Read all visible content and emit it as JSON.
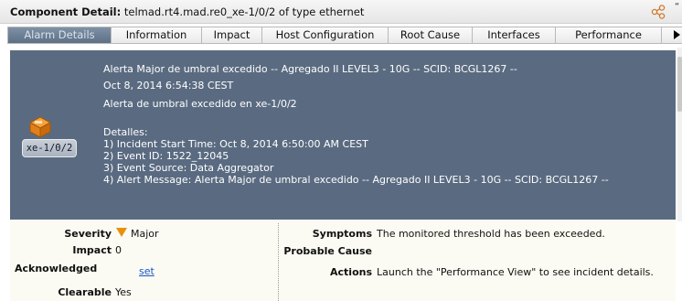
{
  "header": {
    "title_bold": "Component Detail:",
    "title_rest": " telmad.rt4.mad.re0_xe-1/0/2 of type ethernet",
    "share_icon": "share-icon"
  },
  "tabs": [
    {
      "label": "Alarm Details",
      "active": true
    },
    {
      "label": "Information",
      "active": false
    },
    {
      "label": "Impact",
      "active": false
    },
    {
      "label": "Host Configuration",
      "active": false
    },
    {
      "label": "Root Cause",
      "active": false
    },
    {
      "label": "Interfaces",
      "active": false
    },
    {
      "label": "Performance",
      "active": false
    }
  ],
  "alarm": {
    "headline": "Alerta Major de umbral excedido -- Agregado II LEVEL3 - 10G -- SCID: BCGL1267 --",
    "timestamp": "Oct 8, 2014 6:54:38 CEST",
    "summary": "Alerta de umbral excedido en xe-1/0/2",
    "details_title": "Detalles:",
    "details": [
      "1) Incident Start Time: Oct 8, 2014 6:50:00 AM CEST",
      "2) Event ID: 1522_12045",
      "3) Event Source: Data Aggregator",
      "4) Alert Message: Alerta Major de umbral excedido -- Agregado II LEVEL3 - 10G -- SCID: BCGL1267 --"
    ],
    "device_label": "xe-1/0/2"
  },
  "fields": {
    "severity_label": "Severity",
    "severity_value": "Major",
    "impact_label": "Impact",
    "impact_value": "0",
    "acknowledged_label": "Acknowledged",
    "acknowledged_link": "set",
    "clearable_label": "Clearable",
    "clearable_value": "Yes",
    "symptoms_label": "Symptoms",
    "symptoms_value": "The monitored threshold has been exceeded.",
    "probable_cause_label": "Probable Cause",
    "actions_label": "Actions",
    "actions_value": "Launch the \"Performance View\" to see incident details."
  },
  "colors": {
    "alarm_panel_bg": "#5a6b81",
    "severity_major": "#e9900f",
    "link": "#1a56c4"
  }
}
